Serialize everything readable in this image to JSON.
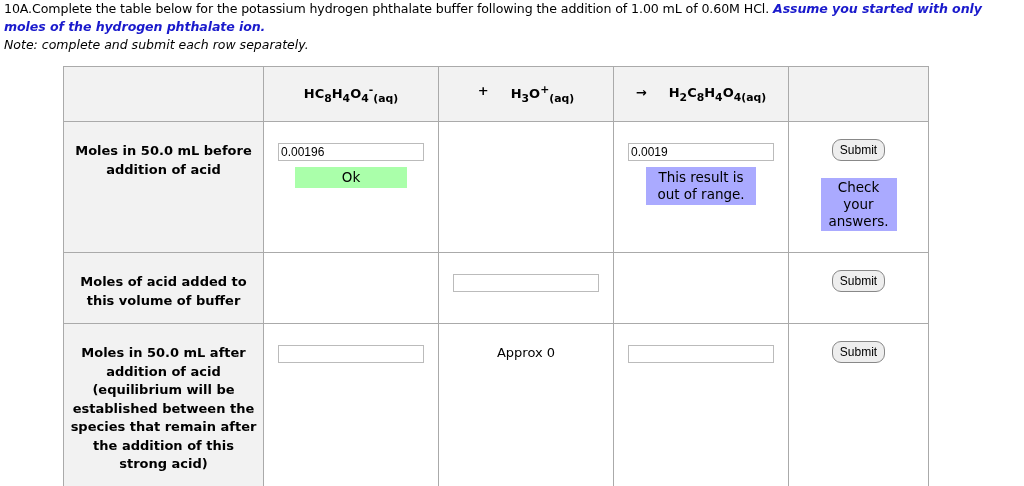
{
  "intro": {
    "text": "10A.Complete the table below for the potassium hydrogen phthalate buffer following the addition of 1.00 mL of 0.60M HCl.",
    "emphasis": "Assume you started with only moles of the hydrogen phthalate ion."
  },
  "note": "Note: complete and submit each row separately.",
  "header": [
    {
      "species": "HC$_{8}$H$_{4}$O$_{4}$$^{-}$$_{(aq)}$"
    },
    {
      "operator": "+",
      "species": "H$_{3}$O$^{+}$$_{(aq)}$"
    },
    {
      "operator": "→",
      "species": "H$_{2}$C$_{8}$H$_{4}$O$_{4(aq)}$"
    }
  ],
  "rows": [
    {
      "label": "Moles in 50.0 mL before addition of acid",
      "cells": [
        {
          "kind": "input",
          "value": "0.00196",
          "feedback": {
            "kind": "ok",
            "text": "Ok"
          }
        },
        {
          "kind": "empty"
        },
        {
          "kind": "input",
          "value": "0.0019",
          "feedback": {
            "kind": "error",
            "text": "This result is out of range."
          }
        }
      ],
      "button": "Submit",
      "message": "Check your answers."
    },
    {
      "label": "Moles of acid added to this volume of buffer",
      "cells": [
        {
          "kind": "empty"
        },
        {
          "kind": "input"
        },
        {
          "kind": "empty"
        }
      ],
      "button": "Submit"
    },
    {
      "label": "Moles in 50.0 mL after addition of acid (equilibrium will be established between the species that remain after the addition of this strong acid)",
      "cells": [
        {
          "kind": "input"
        },
        {
          "kind": "text",
          "text": "Approx 0"
        },
        {
          "kind": "input"
        }
      ],
      "button": "Submit"
    }
  ]
}
